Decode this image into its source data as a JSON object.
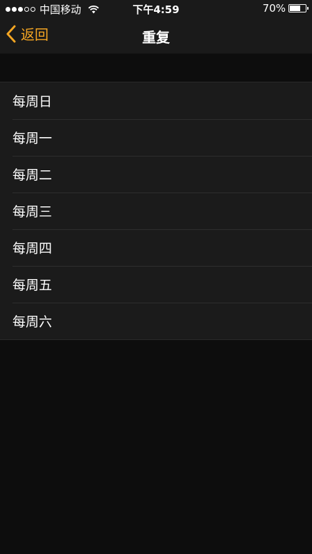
{
  "status_bar": {
    "carrier": "中国移动",
    "signal_bars_on": 3,
    "signal_bars_total": 5,
    "time": "下午4:59",
    "battery_percent_label": "70%",
    "battery_level": 0.7
  },
  "nav": {
    "back_label": "返回",
    "title": "重复"
  },
  "list": {
    "items": [
      {
        "label": "每周日"
      },
      {
        "label": "每周一"
      },
      {
        "label": "每周二"
      },
      {
        "label": "每周三"
      },
      {
        "label": "每周四"
      },
      {
        "label": "每周五"
      },
      {
        "label": "每周六"
      }
    ]
  },
  "colors": {
    "accent": "#f5a623",
    "background": "#0d0d0d",
    "row_background": "#1b1b1b"
  },
  "icons": {
    "back": "chevron-left-icon",
    "wifi": "wifi-icon",
    "battery": "battery-icon"
  }
}
